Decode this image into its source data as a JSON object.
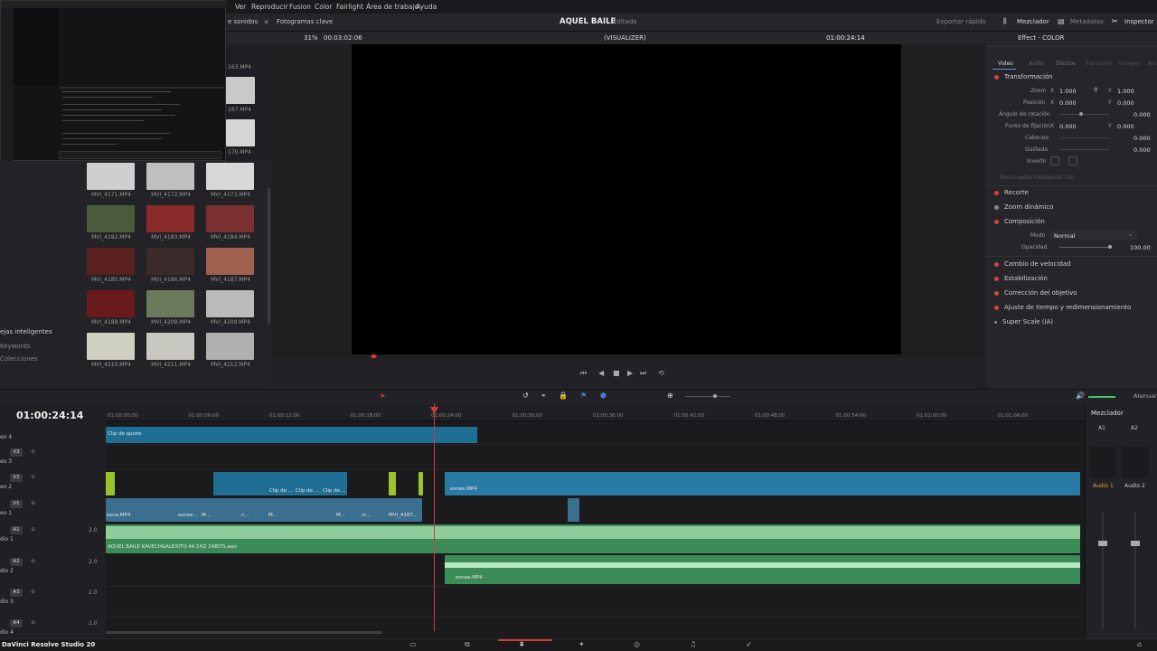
{
  "menu": {
    "items": [
      "Ver",
      "Reproducir",
      "Fusion",
      "Color",
      "Fairlight",
      "Área de trabajo",
      "Ayuda"
    ]
  },
  "toolbar": {
    "sonidos": "e sonidos",
    "fotogramas_clave": "Fotogramas clave",
    "project_title": "AQUEL BAILE",
    "project_status": "Editado",
    "exportar": "Exportar rápido",
    "mezclador": "Mezclador",
    "metadatos": "Metadatos",
    "inspector": "Inspector"
  },
  "viewer": {
    "zoom": "31%",
    "duration": "00:03:02:06",
    "clip_name": "(VISUALIZER)",
    "timecode": "01:00:24:14"
  },
  "media": {
    "top_captions": [
      "163.MP4",
      "167.MP4",
      "170.MP4"
    ],
    "thumbs": [
      [
        "MVI_4171.MP4",
        "MVI_4172.MP4",
        "MVI_4173.MP4"
      ],
      [
        "MVI_4182.MP4",
        "MVI_4183.MP4",
        "MVI_4184.MP4"
      ],
      [
        "MVI_4185.MP4",
        "MVI_4186.MP4",
        "MVI_4187.MP4"
      ],
      [
        "MVI_4188.MP4",
        "MVI_4208.MP4",
        "MVI_4209.MP4"
      ],
      [
        "MVI_4210.MP4",
        "MVI_4211.MP4",
        "MVI_4212.MP4"
      ]
    ]
  },
  "left_panel": {
    "items": [
      "ejas inteligentes",
      "Keywords",
      "Colecciones"
    ]
  },
  "inspector": {
    "title": "Effect - COLOR",
    "tabs": [
      "Video",
      "Audio",
      "Efectos",
      "Transición",
      "Imagen",
      "Arc"
    ],
    "transform_header": "Transformación",
    "zoom_label": "Zoom",
    "zoom_x": "1.000",
    "zoom_y": "1.000",
    "posicion_label": "Posición",
    "pos_x": "0.000",
    "pos_y": "0.000",
    "rotacion_label": "Ángulo de rotación",
    "rotacion_val": "0.000",
    "fijacion_label": "Punto de fijación",
    "fij_x": "0.000",
    "fij_y": "0.000",
    "cabeceo_label": "Cabeceo",
    "cabeceo_val": "0.000",
    "guinada_label": "Guiñada",
    "guinada_val": "0.000",
    "invertir_label": "Invertir",
    "reencuadre": "Reencuadre inteligente (IA)",
    "sections": [
      "Recorte",
      "Zoom dinámico",
      "Composición"
    ],
    "modo_label": "Modo",
    "modo_val": "Normal",
    "opacidad_label": "Opacidad",
    "opacidad_val": "100.00",
    "sections2": [
      "Cambio de velocidad",
      "Estabilización",
      "Corrección del objetivo",
      "Ajuste de tiempo y redimensionamiento",
      "Super Scale (IA)"
    ]
  },
  "timeline": {
    "timecode": "01:00:24:14",
    "atenuar": "Atenuar",
    "ruler": [
      "01:00:00:00",
      "01:00:06:00",
      "01:00:12:00",
      "01:00:18:00",
      "01:00:24:00",
      "01:00:30:00",
      "01:00:36:00",
      "01:00:42:00",
      "01:00:48:00",
      "01:00:54:00",
      "01:01:00:00",
      "01:01:06:00"
    ],
    "tracks": [
      {
        "id": "V3",
        "name": "eo 3"
      },
      {
        "id": "V2",
        "name": "eo 2"
      },
      {
        "id": "V1",
        "name": "eo 1"
      },
      {
        "id": "A1",
        "name": "dio 1",
        "level": "2.0"
      },
      {
        "id": "A2",
        "name": "dio 2",
        "level": "2.0"
      },
      {
        "id": "A3",
        "name": "dio 3",
        "level": "2.0"
      },
      {
        "id": "A4",
        "name": "dio 4",
        "level": "2.0"
      }
    ],
    "top_track_name": "eo 4",
    "adjust_clip": "Clip de ajuste",
    "v2_clips": [
      "Clip de ...",
      "Clip de ...",
      "Clip de ..."
    ],
    "v2_long": "esnee.MP4",
    "v1_clips": [
      "esna.MP4",
      "esnee...",
      "M...",
      "c...",
      "M...",
      "M...",
      "cr...",
      "MVI_4187..."
    ],
    "a1_name": "AQUEL BAILE KAVECH&ALEXITO 44.1HZ 24BITS.wav",
    "a2_name": "esnee.MP4"
  },
  "mixer": {
    "title": "Mezclador",
    "channels": [
      "A1",
      "A2"
    ],
    "labels": [
      "Audio 1",
      "Audio 2"
    ]
  },
  "app": {
    "name": "DaVinci Resolve Studio 20"
  },
  "colors": {
    "adjust_clip": "#1f6e94",
    "video_clip": "#2a7aa6",
    "audio_clip": "#3c8c58",
    "playhead": "#d23a3a"
  }
}
